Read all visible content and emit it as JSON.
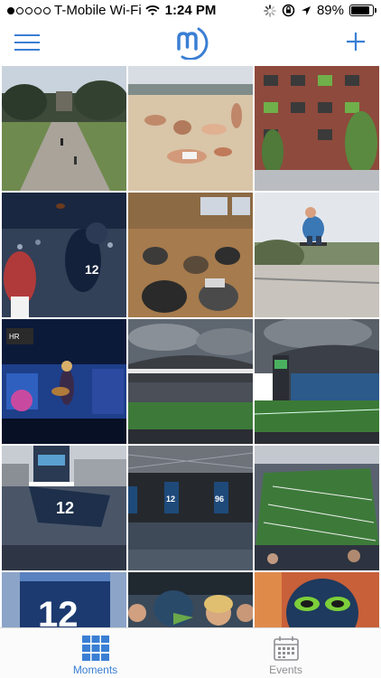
{
  "status_bar": {
    "carrier": "T-Mobile Wi-Fi",
    "time": "1:24 PM",
    "battery_percent": "89%",
    "battery_level": 0.89,
    "signal_dots_filled": 1
  },
  "nav": {
    "menu_icon": "hamburger-menu-icon",
    "logo_icon": "app-logo-icon",
    "add_icon": "plus-icon",
    "accent_color": "#3a7fd4"
  },
  "photos": [
    {
      "subject": "campus-quad"
    },
    {
      "subject": "beach-group"
    },
    {
      "subject": "brick-building"
    },
    {
      "subject": "football-catch"
    },
    {
      "subject": "lecture-hall"
    },
    {
      "subject": "skateboard-jump"
    },
    {
      "subject": "concert-stage"
    },
    {
      "subject": "stadium-cloudy"
    },
    {
      "subject": "stadium-field"
    },
    {
      "subject": "stadium-12-flag"
    },
    {
      "subject": "stadium-roof-banners"
    },
    {
      "subject": "stadium-aerial"
    },
    {
      "subject": "fans-12-sign"
    },
    {
      "subject": "mascot-fans"
    },
    {
      "subject": "fan-mask"
    }
  ],
  "tabs": [
    {
      "label": "Moments",
      "icon": "grid-icon",
      "active": true
    },
    {
      "label": "Events",
      "icon": "calendar-icon",
      "active": false
    }
  ]
}
